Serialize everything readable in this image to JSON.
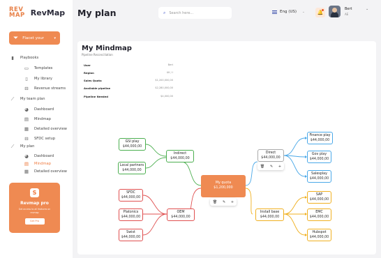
{
  "brand": {
    "logo_mark": "REV MAP",
    "name": "RevMap"
  },
  "header": {
    "title": "My plan",
    "search_placeholder": "Search here...",
    "language": "Eng (US)",
    "user_name": "Bert",
    "user_role": "AE"
  },
  "sidebar": {
    "filter_label": "Flacet your",
    "sections": [
      {
        "label": "Playbooks",
        "icon": "bar-chart-icon"
      },
      {
        "label": "Templates",
        "icon": "document-icon"
      },
      {
        "label": "My library",
        "icon": "book-icon"
      },
      {
        "label": "Revenue streams",
        "icon": "cart-icon"
      },
      {
        "label": "My team plan",
        "icon": "trend-icon"
      },
      {
        "label": "Dashboard",
        "icon": "pie-icon"
      },
      {
        "label": "Mindmap",
        "icon": "map-icon"
      },
      {
        "label": "Detailed overview",
        "icon": "table-icon"
      },
      {
        "label": "SFDC setup",
        "icon": "cart-icon"
      },
      {
        "label": "My plan",
        "icon": "trend-icon"
      },
      {
        "label": "Dashboard",
        "icon": "pie-icon"
      },
      {
        "label": "Mindmap",
        "icon": "map-icon"
      },
      {
        "label": "Detailed overview",
        "icon": "table-icon"
      }
    ],
    "promo": {
      "title": "Revmap pro",
      "desc": "Get access to all features on revmap",
      "button": "Get Pro"
    }
  },
  "mindmap": {
    "title": "My Mindmap",
    "subtitle": "Pipeline Reconciliation",
    "info": [
      {
        "label": "User",
        "value": "Bert"
      },
      {
        "label": "Region",
        "value": "UK / I"
      },
      {
        "label": "Sales Quota",
        "value": "$1,200,000,00"
      },
      {
        "label": "Available pipeline",
        "value": "$2,280,000,00"
      },
      {
        "label": "Pipeline Needed",
        "value": "$4,000,00"
      }
    ],
    "central": {
      "label": "My quota",
      "value": "$1,200,000"
    },
    "nodes": {
      "indirect": {
        "label": "Indirect",
        "value": "$44,000,00"
      },
      "oem": {
        "label": "OEM",
        "value": "$44,000,00"
      },
      "direct": {
        "label": "Direct",
        "value": "$44,000,00"
      },
      "install": {
        "label": "Install base",
        "value": "$44,000,00"
      },
      "gsi": {
        "label": "GSI play",
        "value": "$44,000,00"
      },
      "local": {
        "label": "Local partners",
        "value": "$44,000,00"
      },
      "sfdc": {
        "label": "SFDC",
        "value": "$44,000,00"
      },
      "platonics": {
        "label": "Platonics",
        "value": "$44,000,00"
      },
      "swist": {
        "label": "Swist",
        "value": "$44,000,00"
      },
      "finance": {
        "label": "Finance play",
        "value": "$44,000,00"
      },
      "gov": {
        "label": "Gov play",
        "value": "$44,000,00"
      },
      "salesplay": {
        "label": "Salesplay",
        "value": "$44,000,00"
      },
      "sap": {
        "label": "SAP",
        "value": "$44,000,00"
      },
      "emc": {
        "label": "EMC",
        "value": "$44,000,00"
      },
      "hubspot": {
        "label": "Hubspot",
        "value": "$44,000,00"
      }
    }
  },
  "colors": {
    "accent": "#ef8a52",
    "green": "#4caf50",
    "red": "#e05050",
    "blue": "#4aa8e8",
    "yellow": "#f0b020"
  }
}
